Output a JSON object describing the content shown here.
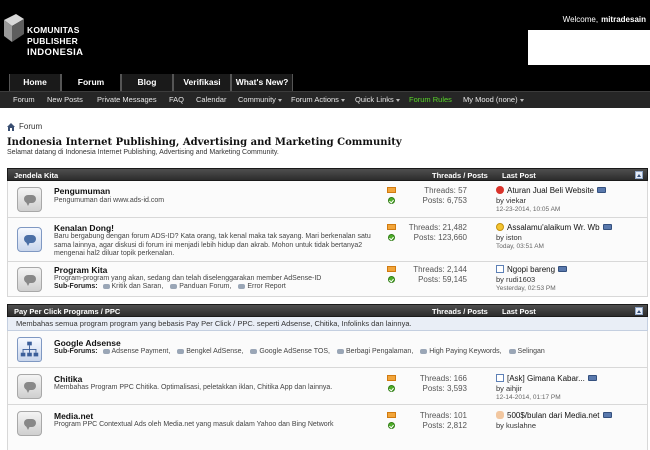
{
  "header": {
    "logo_line1": "KOMUNITAS PUBLISHER",
    "logo_line2": "INDONESIA",
    "welcome": "Welcome,",
    "username": "mitradesain"
  },
  "tabs": [
    {
      "label": "Home"
    },
    {
      "label": "Forum"
    },
    {
      "label": "Blog"
    },
    {
      "label": "Verifikasi"
    },
    {
      "label": "What's New?"
    }
  ],
  "subnav": [
    {
      "label": "Forum"
    },
    {
      "label": "New Posts"
    },
    {
      "label": "Private Messages"
    },
    {
      "label": "FAQ"
    },
    {
      "label": "Calendar"
    },
    {
      "label": "Community"
    },
    {
      "label": "Forum Actions"
    },
    {
      "label": "Quick Links"
    },
    {
      "label": "Forum Rules"
    },
    {
      "label": "My Mood (none)"
    }
  ],
  "breadcrumb": "Forum",
  "page": {
    "title": "Indonesia Internet Publishing, Advertising and Marketing Community",
    "description": "Selamat datang di Indonesia Internet Publishing, Advertising and Marketing Community."
  },
  "columns": {
    "threads_posts": "Threads / Posts",
    "last_post": "Last Post"
  },
  "categories": [
    {
      "title": "Jendela Kita",
      "forums": [
        {
          "name": "Pengumuman",
          "desc": "Pengumuman dari www.ads-id.com",
          "threads": "Threads: 57",
          "posts": "Posts: 6,753",
          "last_title": "Aturan Jual Beli Website",
          "last_by": "by viekar",
          "last_date": "12-23-2014, 10:05 AM"
        },
        {
          "name": "Kenalan Dong!",
          "desc": "Baru bergabung dengan forum ADS-ID? Kata orang, tak kenal maka tak sayang. Mari berkenalan satu sama lainnya, agar diskusi di forum ini menjadi lebih hidup dan akrab. Mohon untuk tidak bertanya2 mengenai hal2 diluar topik perkenalan.",
          "threads": "Threads: 21,482",
          "posts": "Posts: 123,660",
          "last_title": "Assalamu'alaikum Wr. Wb",
          "last_by": "by iston",
          "last_date": "Today, 03:51 AM"
        },
        {
          "name": "Program Kita",
          "desc": "Program-program yang akan, sedang dan telah diselenggarakan member AdSense-ID",
          "subforums_label": "Sub-Forums:",
          "subforums": [
            "Kritik dan Saran,",
            "Panduan Forum,",
            "Error Report"
          ],
          "threads": "Threads: 2,144",
          "posts": "Posts: 59,145",
          "last_title": "Ngopi bareng",
          "last_by": "by rudi1603",
          "last_date": "Yesterday, 02:53 PM"
        }
      ]
    },
    {
      "title": "Pay Per Click Programs / PPC",
      "description": "Membahas semua program program yang bebasis Pay Per Click / PPC. seperti Adsense, Chitika, Infolinks dan lainnya.",
      "forums": [
        {
          "name": "Google Adsense",
          "subforums_label": "Sub-Forums:",
          "subforums": [
            "Adsense Payment,",
            "Bengkel AdSense,",
            "Google AdSense TOS,",
            "Berbagi Pengalaman,",
            "High Paying Keywords,",
            "Selingan"
          ]
        },
        {
          "name": "Chitika",
          "desc": "Membahas Program PPC Chitika. Optimalisasi, peletakkan iklan, Chitika App dan lainnya.",
          "threads": "Threads: 166",
          "posts": "Posts: 3,593",
          "last_title": "[Ask] Gimana Kabar...",
          "last_by": "by aihjir",
          "last_date": "12-14-2014, 01:17 PM"
        },
        {
          "name": "Media.net",
          "desc": "Program PPC Contextual Ads oleh Media.net yang masuk dalam Yahoo dan Bing Network",
          "threads": "Threads: 101",
          "posts": "Posts: 2,812",
          "last_title": "500$/bulan dari Media.net",
          "last_by": "by kuslahne"
        }
      ]
    }
  ]
}
